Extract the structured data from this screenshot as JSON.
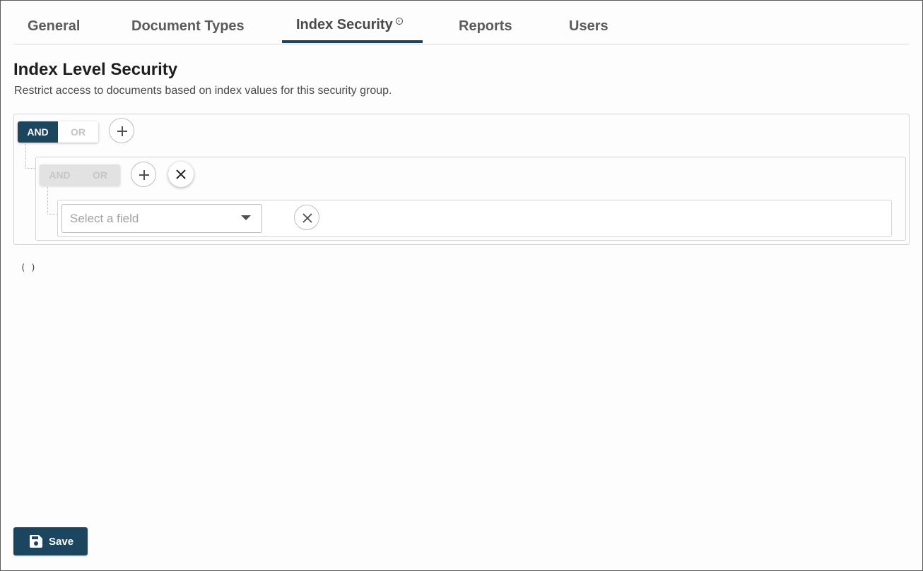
{
  "tabs": [
    {
      "label": "General"
    },
    {
      "label": "Document Types"
    },
    {
      "label": "Index Security",
      "active": true,
      "icon": "info-icon"
    },
    {
      "label": "Reports"
    },
    {
      "label": "Users"
    }
  ],
  "page": {
    "title": "Index Level Security",
    "subtitle": "Restrict access to documents based on index values for this security group."
  },
  "query_builder": {
    "root_group": {
      "and_label": "AND",
      "or_label": "OR",
      "selected": "AND",
      "add_icon": "plus-icon"
    },
    "sub_group": {
      "and_label": "AND",
      "or_label": "OR",
      "disabled": true,
      "add_icon": "plus-icon",
      "remove_icon": "close-icon"
    },
    "rule": {
      "field_placeholder": "Select a field",
      "dropdown_icon": "caret-down-icon",
      "remove_icon": "close-icon"
    },
    "query_preview": "( )"
  },
  "footer": {
    "save_label": "Save",
    "save_icon": "floppy-disk-icon"
  },
  "colors": {
    "accent": "#1c4560",
    "border": "#d4d4d4",
    "muted_text": "#a2a2a2"
  }
}
